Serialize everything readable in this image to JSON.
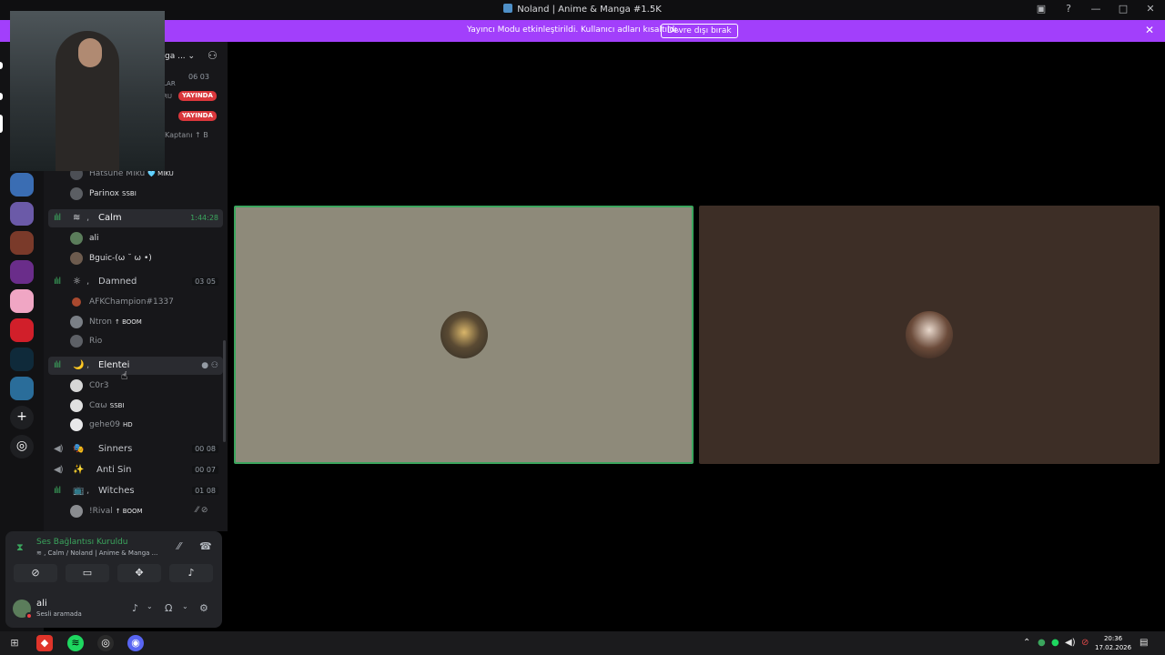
{
  "window": {
    "title": "Noland | Anime & Manga #1.5K",
    "controls": [
      "—",
      "□",
      "✕"
    ]
  },
  "banner": {
    "message": "Yayıncı Modu etkinleştirildi. Kullanıcı adları kısaltıldı.",
    "button": "Devre dışı bırak"
  },
  "server_header": {
    "name": "ga ...",
    "chevron": "⌄"
  },
  "partial": {
    "counts": "06 03",
    "lar": "LAR",
    "ru": "RU",
    "live": "YAYINDA",
    "kaptan": "Kaptanı ↑ B"
  },
  "users_top": [
    {
      "name": "Hatsune Miku",
      "tag": "🩵 MIKU"
    },
    {
      "name": "Parinox",
      "tag": "SSBI"
    }
  ],
  "channels": [
    {
      "id": "calm",
      "emoji": "≋",
      "name": "Calm",
      "meta": "1:44:28"
    },
    {
      "id": "damned",
      "emoji": "☼",
      "name": "Damned",
      "meta": "03 05"
    },
    {
      "id": "elentei",
      "emoji": "🌙",
      "name": "Elentei"
    },
    {
      "id": "sinners",
      "emoji": "🎭",
      "name": "Sinners",
      "meta": "00 08"
    },
    {
      "id": "antisin",
      "emoji": "✨",
      "name": "Anti Sin",
      "meta": "00 07"
    },
    {
      "id": "witches",
      "emoji": "📺",
      "name": "Witches",
      "meta": "01 08"
    }
  ],
  "calm_users": [
    {
      "name": "ali"
    },
    {
      "name": "Bguic-(ω ˘ ω •)"
    }
  ],
  "damned_users": [
    {
      "name": "AFKChampion#1337"
    },
    {
      "name": "Ntron",
      "tag": "↑ BOOM"
    },
    {
      "name": "Rio"
    }
  ],
  "elentei_users": [
    {
      "name": "C0r3"
    },
    {
      "name": "Cαω",
      "tag": "SSBI"
    },
    {
      "name": "gehe09",
      "tag": "HD"
    }
  ],
  "witches_users": [
    {
      "name": "!Rival",
      "tag": "↑ BOOM"
    }
  ],
  "voice": {
    "status": "Ses Bağlantısı Kuruldu",
    "sub": "≋ , Calm / Noland | Anime & Manga ..."
  },
  "user": {
    "name": "ali",
    "status": "Sesli aramada"
  },
  "taskbar": {
    "time": "20:36",
    "date": "17.02.2026"
  },
  "colors": {
    "accent_green": "#3ba55d",
    "banner": "#a23ffb",
    "live_red": "#da373c"
  }
}
